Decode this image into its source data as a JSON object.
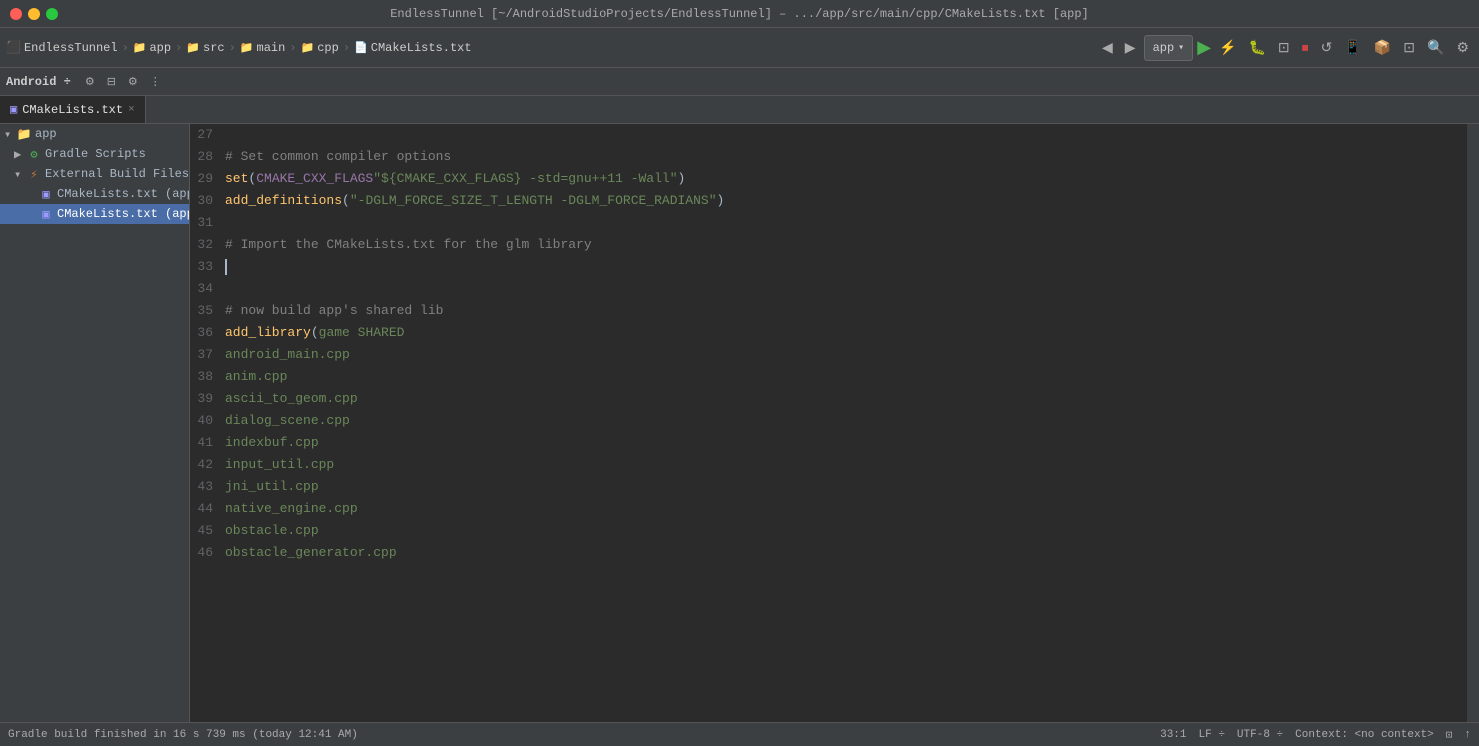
{
  "titleBar": {
    "text": "EndlessTunnel [~/AndroidStudioProjects/EndlessTunnel] – .../app/src/main/cpp/CMakeLists.txt [app]",
    "trafficLights": [
      "red",
      "yellow",
      "green"
    ]
  },
  "breadcrumb": {
    "items": [
      "EndlessTunnel",
      "app",
      "src",
      "main",
      "cpp",
      "CMakeLists.txt"
    ]
  },
  "toolbar": {
    "appSelector": "app",
    "runBtn": "▶",
    "icons": [
      "◀",
      "▶",
      "⊡",
      "↺",
      "⏸",
      "⏹",
      "↯",
      "📷",
      "📊",
      "⚙",
      "🔍",
      "⚡"
    ]
  },
  "tabs": [
    {
      "label": "CMakeLists.txt",
      "active": true,
      "closeable": true
    }
  ],
  "sidebar": {
    "panels": [
      "Android"
    ],
    "tree": [
      {
        "level": 0,
        "label": "app",
        "type": "folder",
        "expanded": true
      },
      {
        "level": 1,
        "label": "Gradle Scripts",
        "type": "gradle",
        "expanded": false
      },
      {
        "level": 1,
        "label": "External Build Files",
        "type": "external",
        "expanded": true
      },
      {
        "level": 2,
        "label": "CMakeLists.txt (app, ...)",
        "type": "cmake",
        "selected": false
      },
      {
        "level": 2,
        "label": "CMakeLists.txt (app, ...)",
        "type": "cmake",
        "selected": true
      }
    ]
  },
  "editor": {
    "lines": [
      {
        "num": "27",
        "content": ""
      },
      {
        "num": "28",
        "tokens": [
          {
            "type": "cm",
            "text": "# Set common compiler options"
          }
        ]
      },
      {
        "num": "29",
        "tokens": [
          {
            "type": "fn",
            "text": "set"
          },
          {
            "type": "plain",
            "text": "("
          },
          {
            "type": "var",
            "text": "CMAKE_CXX_FLAGS"
          },
          {
            "type": "plain",
            "text": " "
          },
          {
            "type": "str",
            "text": "\"${CMAKE_CXX_FLAGS} -std=gnu++11 -Wall\""
          },
          {
            "type": "plain",
            "text": ")"
          }
        ]
      },
      {
        "num": "30",
        "tokens": [
          {
            "type": "fn",
            "text": "add_definitions"
          },
          {
            "type": "plain",
            "text": "("
          },
          {
            "type": "str",
            "text": "\"-DGLM_FORCE_SIZE_T_LENGTH -DGLM_FORCE_RADIANS\""
          },
          {
            "type": "plain",
            "text": ")"
          }
        ]
      },
      {
        "num": "31",
        "content": ""
      },
      {
        "num": "32",
        "tokens": [
          {
            "type": "cm",
            "text": "# Import the CMakeLists.txt for the glm library"
          }
        ]
      },
      {
        "num": "33",
        "content": ""
      },
      {
        "num": "34",
        "content": ""
      },
      {
        "num": "35",
        "tokens": [
          {
            "type": "cm",
            "text": "# now build app's shared lib"
          }
        ]
      },
      {
        "num": "36",
        "tokens": [
          {
            "type": "fn",
            "text": "add_library"
          },
          {
            "type": "plain",
            "text": "("
          },
          {
            "type": "arg",
            "text": "game SHARED"
          }
        ]
      },
      {
        "num": "37",
        "tokens": [
          {
            "type": "srcfile",
            "text": "        android_main.cpp"
          }
        ]
      },
      {
        "num": "38",
        "tokens": [
          {
            "type": "srcfile",
            "text": "        anim.cpp"
          }
        ]
      },
      {
        "num": "39",
        "tokens": [
          {
            "type": "srcfile",
            "text": "        ascii_to_geom.cpp"
          }
        ]
      },
      {
        "num": "40",
        "tokens": [
          {
            "type": "srcfile",
            "text": "        dialog_scene.cpp"
          }
        ]
      },
      {
        "num": "41",
        "tokens": [
          {
            "type": "srcfile",
            "text": "        indexbuf.cpp"
          }
        ]
      },
      {
        "num": "42",
        "tokens": [
          {
            "type": "srcfile",
            "text": "        input_util.cpp"
          }
        ]
      },
      {
        "num": "43",
        "tokens": [
          {
            "type": "srcfile",
            "text": "        jni_util.cpp"
          }
        ]
      },
      {
        "num": "44",
        "tokens": [
          {
            "type": "srcfile",
            "text": "        native_engine.cpp"
          }
        ]
      },
      {
        "num": "45",
        "tokens": [
          {
            "type": "srcfile",
            "text": "        obstacle.cpp"
          }
        ]
      },
      {
        "num": "46",
        "tokens": [
          {
            "type": "srcfile",
            "text": "        obstacle_generator.cpp"
          }
        ]
      }
    ]
  },
  "statusBar": {
    "left": "Gradle build finished in 16 s 739 ms (today 12:41 AM)",
    "position": "33:1",
    "lineEnding": "LF: ÷",
    "encoding": "UTF-8÷",
    "context": "Context: <no context>",
    "icons": [
      "⊡",
      "↑"
    ]
  }
}
